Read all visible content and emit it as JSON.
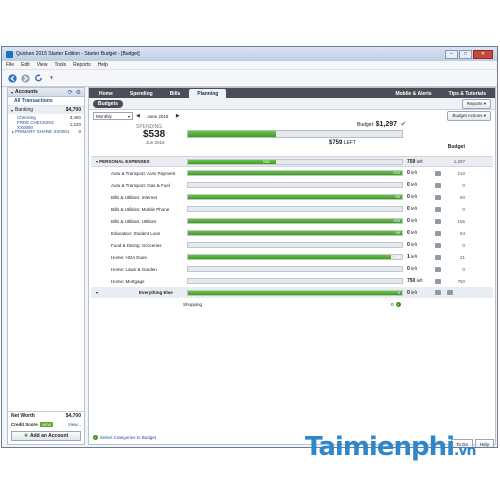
{
  "window": {
    "title": "Quicken 2015 Starter Edition - Starter Budget - [Budget]",
    "min": "–",
    "max": "□",
    "close": "✕"
  },
  "menu": [
    "File",
    "Edit",
    "View",
    "Tools",
    "Reports",
    "Help"
  ],
  "toolbar": {
    "icons": [
      "back-arrow-icon",
      "forward-arrow-icon",
      "refresh-icon"
    ]
  },
  "sidebar": {
    "header": "Accounts",
    "all_transactions": "All Transactions",
    "banking": {
      "label": "Banking",
      "amount": "$4,700"
    },
    "accounts": [
      {
        "name": "Checking",
        "amount": "3,480"
      },
      {
        "name": "FREE CHECKING XX0090",
        "amount": "1,220"
      },
      {
        "name": "PRIMARY SHARE XX0001",
        "amount": "0"
      }
    ],
    "net_worth": {
      "label": "Net Worth",
      "amount": "$4,700"
    },
    "credit_score": {
      "label": "Credit Score",
      "badge": "NEW",
      "link": "View..."
    },
    "add_account": "Add an Account"
  },
  "tabs": [
    "Home",
    "Spending",
    "Bills",
    "Planning"
  ],
  "active_tab": "Planning",
  "right_tabs": [
    "Mobile & Alerts",
    "Tips & Tutorials"
  ],
  "subbar": {
    "pill": "Budgets",
    "reports": "Reports"
  },
  "controls": {
    "period": "Monthly",
    "month": "June 2015",
    "budget_actions": "Budget Actions"
  },
  "summary": {
    "spending_label": "SPENDING",
    "spending_value": "$538",
    "month": "Jun 2015",
    "budget_label": "Budget:",
    "budget_value": "$1,297",
    "left_value": "$759",
    "left_label": "LEFT",
    "progress": 0.41
  },
  "table": {
    "budget_header": "Budget",
    "group": {
      "name": "PERSONAL EXPENSES",
      "bar_label": "538",
      "remaining": "759",
      "remaining_label": "left",
      "budget": "1,297",
      "progress": 0.41
    },
    "rows": [
      {
        "name": "Auto & Transport: Auto Payment",
        "bar_label": "210",
        "remaining": "0",
        "label": "left",
        "budget": "210",
        "progress": 1.0
      },
      {
        "name": "Auto & Transport: Gas & Fuel",
        "bar_label": "",
        "remaining": "0",
        "label": "left",
        "budget": "0",
        "progress": 0.0
      },
      {
        "name": "Bills & Utilities: Internet",
        "bar_label": "60",
        "remaining": "0",
        "label": "left",
        "budget": "60",
        "progress": 1.0
      },
      {
        "name": "Bills & Utilities: Mobile Phone",
        "bar_label": "",
        "remaining": "0",
        "label": "left",
        "budget": "0",
        "progress": 0.0
      },
      {
        "name": "Bills & Utilities: Utilities",
        "bar_label": "155",
        "remaining": "0",
        "label": "left",
        "budget": "155",
        "progress": 1.0
      },
      {
        "name": "Education: Student Loan",
        "bar_label": "54",
        "remaining": "0",
        "label": "left",
        "budget": "54",
        "progress": 1.0
      },
      {
        "name": "Food & Dining: Groceries",
        "bar_label": "",
        "remaining": "0",
        "label": "left",
        "budget": "0",
        "progress": 0.0
      },
      {
        "name": "Home: HOA Dues",
        "bar_label": "20",
        "remaining": "1",
        "label": "left",
        "budget": "21",
        "progress": 0.95
      },
      {
        "name": "Home: Lawn & Garden",
        "bar_label": "",
        "remaining": "0",
        "label": "left",
        "budget": "0",
        "progress": 0.0
      },
      {
        "name": "Home: Mortgage",
        "bar_label": "",
        "remaining": "750",
        "label": "left",
        "budget": "750",
        "progress": 0.0
      }
    ],
    "everything_else": {
      "name": "Everything Else",
      "bar_label": "0",
      "remaining": "0",
      "label": "left",
      "progress": 1.0
    },
    "shopping": {
      "name": "Shopping",
      "value": "0"
    }
  },
  "footer": {
    "select_categories": "Select Categories to Budget",
    "todo": "To Do",
    "help": "Help"
  },
  "watermark": {
    "brand": "Taimienphi",
    "suffix": ".vn"
  },
  "colors": {
    "accent": "#3d9a23",
    "tabbar": "#4a4f57",
    "link": "#1d4e8f"
  }
}
